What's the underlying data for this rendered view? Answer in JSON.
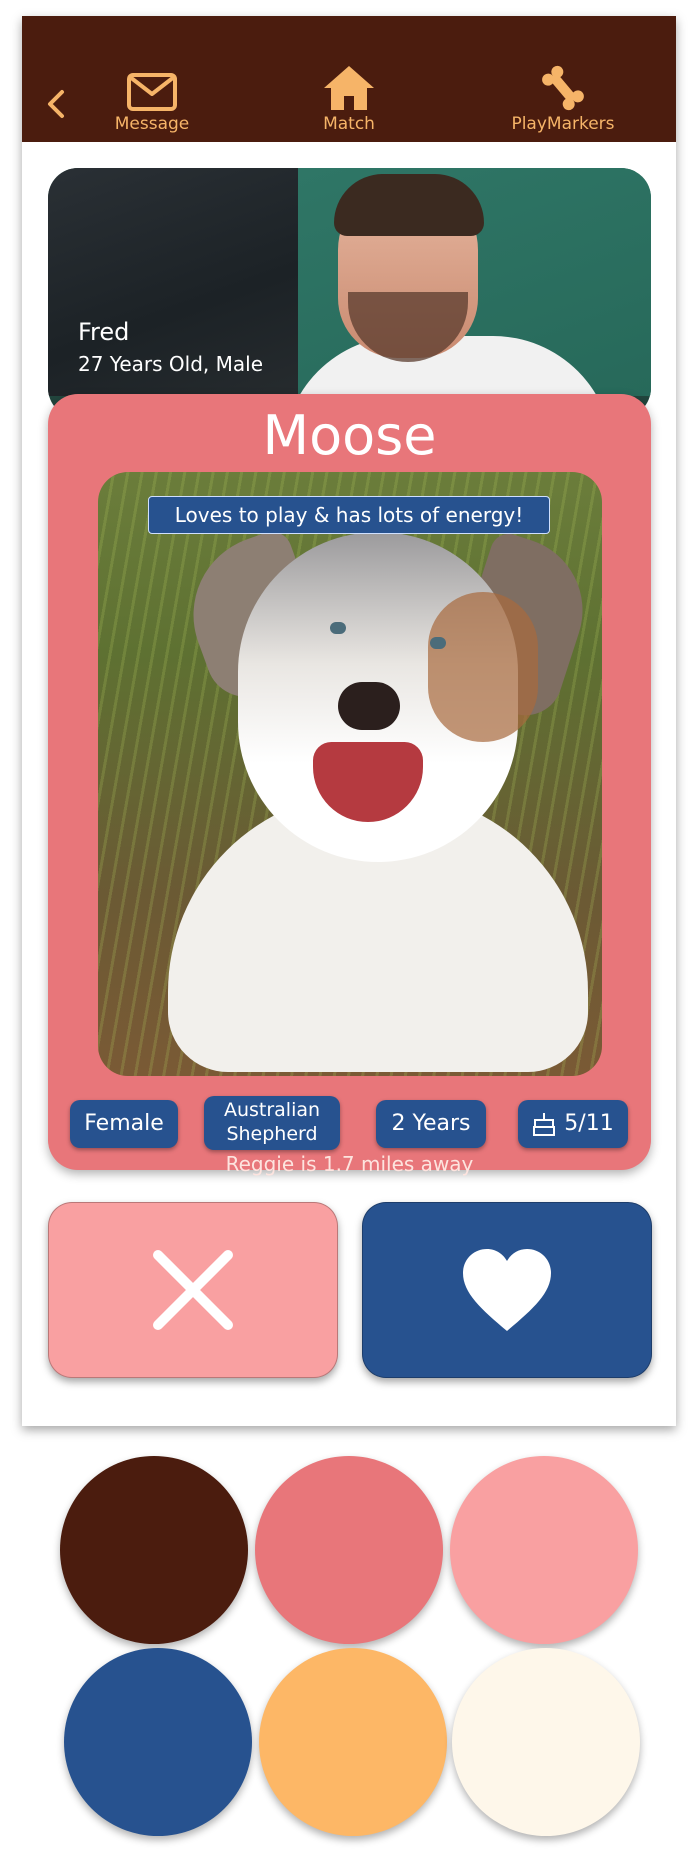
{
  "header": {
    "nav": [
      {
        "label": "Message",
        "icon": "envelope-icon"
      },
      {
        "label": "Match",
        "icon": "house-icon"
      },
      {
        "label": "PlayMarkers",
        "icon": "bone-icon"
      }
    ],
    "accent_color": "#f6b468",
    "background_color": "#4b1c0e"
  },
  "owner": {
    "name": "Fred",
    "info": "27 Years Old, Male"
  },
  "dog": {
    "name": "Moose",
    "bio": "Loves to play & has lots of energy!",
    "tags": {
      "sex": "Female",
      "breed": "Australian Shepherd",
      "breed_line1": "Australian",
      "breed_line2": "Shepherd",
      "age": "2 Years",
      "birthday": "5/11"
    },
    "distance": "Reggie is 1.7 miles away"
  },
  "actions": {
    "pass_icon": "x-icon",
    "like_icon": "heart-icon"
  },
  "palette": [
    "#4b1c0e",
    "#e8767a",
    "#f9a0a1",
    "#27528f",
    "#fdb766",
    "#fef7ea"
  ]
}
